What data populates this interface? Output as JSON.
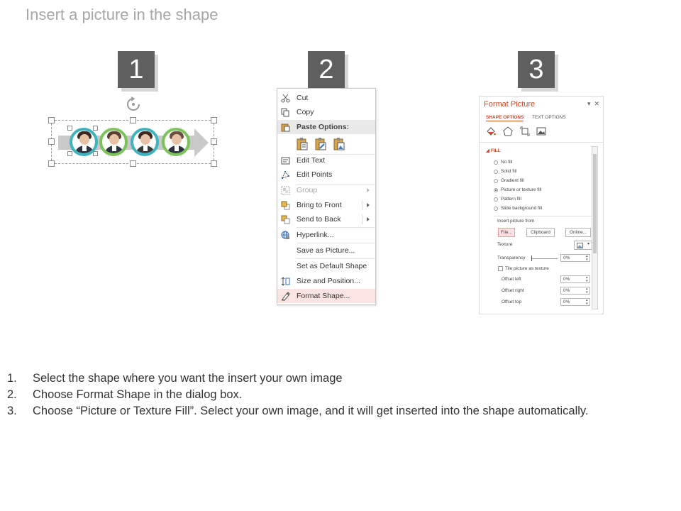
{
  "page": {
    "title": "Insert a picture in the shape"
  },
  "steps": [
    {
      "number": "1"
    },
    {
      "number": "2"
    },
    {
      "number": "3"
    }
  ],
  "panel1": {
    "ring_colors": [
      "#3fb4bf",
      "#7bc35a",
      "#3fb4bf",
      "#7bc35a"
    ],
    "arrow_color": "#c9c9c9"
  },
  "context_menu": {
    "items": [
      {
        "label": "Cut",
        "icon": "scissors-icon",
        "disabled": false
      },
      {
        "label": "Copy",
        "icon": "copy-icon",
        "disabled": false
      },
      {
        "label": "Edit Text",
        "icon": "edit-text-icon",
        "disabled": false
      },
      {
        "label": "Edit Points",
        "icon": "edit-points-icon",
        "disabled": false
      },
      {
        "label": "Group",
        "icon": "group-icon",
        "disabled": true,
        "submenu": true
      },
      {
        "label": "Bring to Front",
        "icon": "bring-to-front-icon",
        "disabled": false,
        "submenu": true
      },
      {
        "label": "Send to Back",
        "icon": "send-to-back-icon",
        "disabled": false,
        "submenu": true
      },
      {
        "label": "Hyperlink...",
        "icon": "hyperlink-icon",
        "disabled": false
      },
      {
        "label": "Save as Picture...",
        "icon": "",
        "disabled": false
      },
      {
        "label": "Set as Default Shape",
        "icon": "",
        "disabled": false
      },
      {
        "label": "Size and Position...",
        "icon": "size-position-icon",
        "disabled": false
      },
      {
        "label": "Format Shape...",
        "icon": "format-shape-icon",
        "disabled": false,
        "highlight": true
      }
    ],
    "paste_options_label": "Paste Options:",
    "paste_option_icons": [
      "paste-keep-source-icon",
      "paste-use-destination-icon",
      "paste-picture-icon"
    ]
  },
  "format_pane": {
    "title": "Format Picture",
    "tabs": {
      "shape_options": "SHAPE OPTIONS",
      "text_options": "TEXT OPTIONS"
    },
    "category_icons": [
      "fill-line-icon",
      "effects-icon",
      "size-properties-icon",
      "picture-icon"
    ],
    "section": "FILL",
    "fill_options": [
      {
        "label": "No fill",
        "selected": false
      },
      {
        "label": "Solid fill",
        "selected": false
      },
      {
        "label": "Gradient fill",
        "selected": false
      },
      {
        "label": "Picture or texture fill",
        "selected": true
      },
      {
        "label": "Pattern fill",
        "selected": false
      },
      {
        "label": "Slide background fill",
        "selected": false
      }
    ],
    "insert_picture_from": "Insert picture from",
    "buttons": {
      "file": "File...",
      "clipboard": "Clipboard",
      "online": "Online..."
    },
    "texture_label": "Texture",
    "transparency_label": "Transparency",
    "transparency_value": "0%",
    "tile_label": "Tile picture as texture",
    "offset_left_label": "Offset left",
    "offset_left_value": "0%",
    "offset_right_label": "Offset right",
    "offset_right_value": "0%",
    "offset_top_label": "Offset top",
    "offset_top_value": "0%",
    "accent_color": "#d24726"
  },
  "instructions": [
    {
      "number": "1.",
      "text": "Select the shape where you want the insert your own image"
    },
    {
      "number": "2.",
      "text": "Choose Format Shape in the dialog box."
    },
    {
      "number": "3.",
      "text": "Choose “Picture or Texture Fill”. Select your own image, and it will get inserted into the shape automatically."
    }
  ]
}
